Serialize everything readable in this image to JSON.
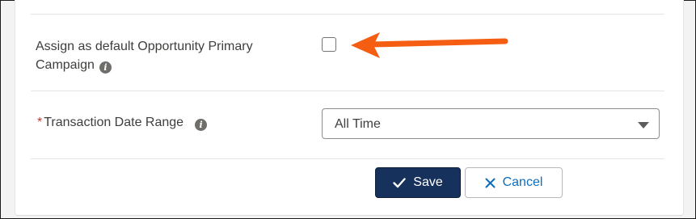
{
  "form": {
    "primary_campaign": {
      "label_line1": "Assign as default Opportunity Primary",
      "label_line2": "Campaign",
      "info_icon": "info-icon",
      "checked": false
    },
    "transaction_date_range": {
      "required_marker": "*",
      "label": "Transaction Date Range",
      "info_icon": "info-icon",
      "selected_value": "All Time"
    }
  },
  "actions": {
    "save_label": "Save",
    "save_icon": "check-icon",
    "cancel_label": "Cancel",
    "cancel_icon": "close-icon"
  },
  "annotation": {
    "arrow_icon": "arrow-left-icon",
    "arrow_color": "#f45d12"
  },
  "colors": {
    "save_bg": "#16325c",
    "cancel_text": "#0b6ebe",
    "required": "#c23934"
  }
}
